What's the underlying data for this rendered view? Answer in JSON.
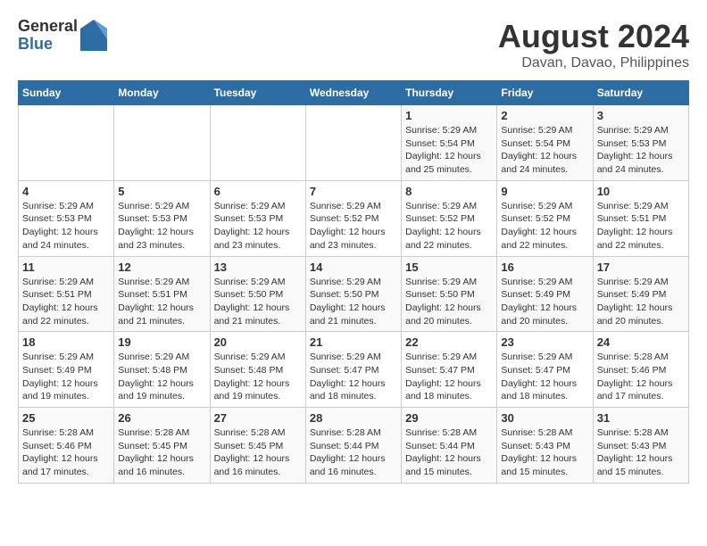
{
  "header": {
    "logo_general": "General",
    "logo_blue": "Blue",
    "month_year": "August 2024",
    "location": "Davan, Davao, Philippines"
  },
  "days_of_week": [
    "Sunday",
    "Monday",
    "Tuesday",
    "Wednesday",
    "Thursday",
    "Friday",
    "Saturday"
  ],
  "weeks": [
    [
      {
        "day": "",
        "info": ""
      },
      {
        "day": "",
        "info": ""
      },
      {
        "day": "",
        "info": ""
      },
      {
        "day": "",
        "info": ""
      },
      {
        "day": "1",
        "info": "Sunrise: 5:29 AM\nSunset: 5:54 PM\nDaylight: 12 hours\nand 25 minutes."
      },
      {
        "day": "2",
        "info": "Sunrise: 5:29 AM\nSunset: 5:54 PM\nDaylight: 12 hours\nand 24 minutes."
      },
      {
        "day": "3",
        "info": "Sunrise: 5:29 AM\nSunset: 5:53 PM\nDaylight: 12 hours\nand 24 minutes."
      }
    ],
    [
      {
        "day": "4",
        "info": "Sunrise: 5:29 AM\nSunset: 5:53 PM\nDaylight: 12 hours\nand 24 minutes."
      },
      {
        "day": "5",
        "info": "Sunrise: 5:29 AM\nSunset: 5:53 PM\nDaylight: 12 hours\nand 23 minutes."
      },
      {
        "day": "6",
        "info": "Sunrise: 5:29 AM\nSunset: 5:53 PM\nDaylight: 12 hours\nand 23 minutes."
      },
      {
        "day": "7",
        "info": "Sunrise: 5:29 AM\nSunset: 5:52 PM\nDaylight: 12 hours\nand 23 minutes."
      },
      {
        "day": "8",
        "info": "Sunrise: 5:29 AM\nSunset: 5:52 PM\nDaylight: 12 hours\nand 22 minutes."
      },
      {
        "day": "9",
        "info": "Sunrise: 5:29 AM\nSunset: 5:52 PM\nDaylight: 12 hours\nand 22 minutes."
      },
      {
        "day": "10",
        "info": "Sunrise: 5:29 AM\nSunset: 5:51 PM\nDaylight: 12 hours\nand 22 minutes."
      }
    ],
    [
      {
        "day": "11",
        "info": "Sunrise: 5:29 AM\nSunset: 5:51 PM\nDaylight: 12 hours\nand 22 minutes."
      },
      {
        "day": "12",
        "info": "Sunrise: 5:29 AM\nSunset: 5:51 PM\nDaylight: 12 hours\nand 21 minutes."
      },
      {
        "day": "13",
        "info": "Sunrise: 5:29 AM\nSunset: 5:50 PM\nDaylight: 12 hours\nand 21 minutes."
      },
      {
        "day": "14",
        "info": "Sunrise: 5:29 AM\nSunset: 5:50 PM\nDaylight: 12 hours\nand 21 minutes."
      },
      {
        "day": "15",
        "info": "Sunrise: 5:29 AM\nSunset: 5:50 PM\nDaylight: 12 hours\nand 20 minutes."
      },
      {
        "day": "16",
        "info": "Sunrise: 5:29 AM\nSunset: 5:49 PM\nDaylight: 12 hours\nand 20 minutes."
      },
      {
        "day": "17",
        "info": "Sunrise: 5:29 AM\nSunset: 5:49 PM\nDaylight: 12 hours\nand 20 minutes."
      }
    ],
    [
      {
        "day": "18",
        "info": "Sunrise: 5:29 AM\nSunset: 5:49 PM\nDaylight: 12 hours\nand 19 minutes."
      },
      {
        "day": "19",
        "info": "Sunrise: 5:29 AM\nSunset: 5:48 PM\nDaylight: 12 hours\nand 19 minutes."
      },
      {
        "day": "20",
        "info": "Sunrise: 5:29 AM\nSunset: 5:48 PM\nDaylight: 12 hours\nand 19 minutes."
      },
      {
        "day": "21",
        "info": "Sunrise: 5:29 AM\nSunset: 5:47 PM\nDaylight: 12 hours\nand 18 minutes."
      },
      {
        "day": "22",
        "info": "Sunrise: 5:29 AM\nSunset: 5:47 PM\nDaylight: 12 hours\nand 18 minutes."
      },
      {
        "day": "23",
        "info": "Sunrise: 5:29 AM\nSunset: 5:47 PM\nDaylight: 12 hours\nand 18 minutes."
      },
      {
        "day": "24",
        "info": "Sunrise: 5:28 AM\nSunset: 5:46 PM\nDaylight: 12 hours\nand 17 minutes."
      }
    ],
    [
      {
        "day": "25",
        "info": "Sunrise: 5:28 AM\nSunset: 5:46 PM\nDaylight: 12 hours\nand 17 minutes."
      },
      {
        "day": "26",
        "info": "Sunrise: 5:28 AM\nSunset: 5:45 PM\nDaylight: 12 hours\nand 16 minutes."
      },
      {
        "day": "27",
        "info": "Sunrise: 5:28 AM\nSunset: 5:45 PM\nDaylight: 12 hours\nand 16 minutes."
      },
      {
        "day": "28",
        "info": "Sunrise: 5:28 AM\nSunset: 5:44 PM\nDaylight: 12 hours\nand 16 minutes."
      },
      {
        "day": "29",
        "info": "Sunrise: 5:28 AM\nSunset: 5:44 PM\nDaylight: 12 hours\nand 15 minutes."
      },
      {
        "day": "30",
        "info": "Sunrise: 5:28 AM\nSunset: 5:43 PM\nDaylight: 12 hours\nand 15 minutes."
      },
      {
        "day": "31",
        "info": "Sunrise: 5:28 AM\nSunset: 5:43 PM\nDaylight: 12 hours\nand 15 minutes."
      }
    ]
  ]
}
